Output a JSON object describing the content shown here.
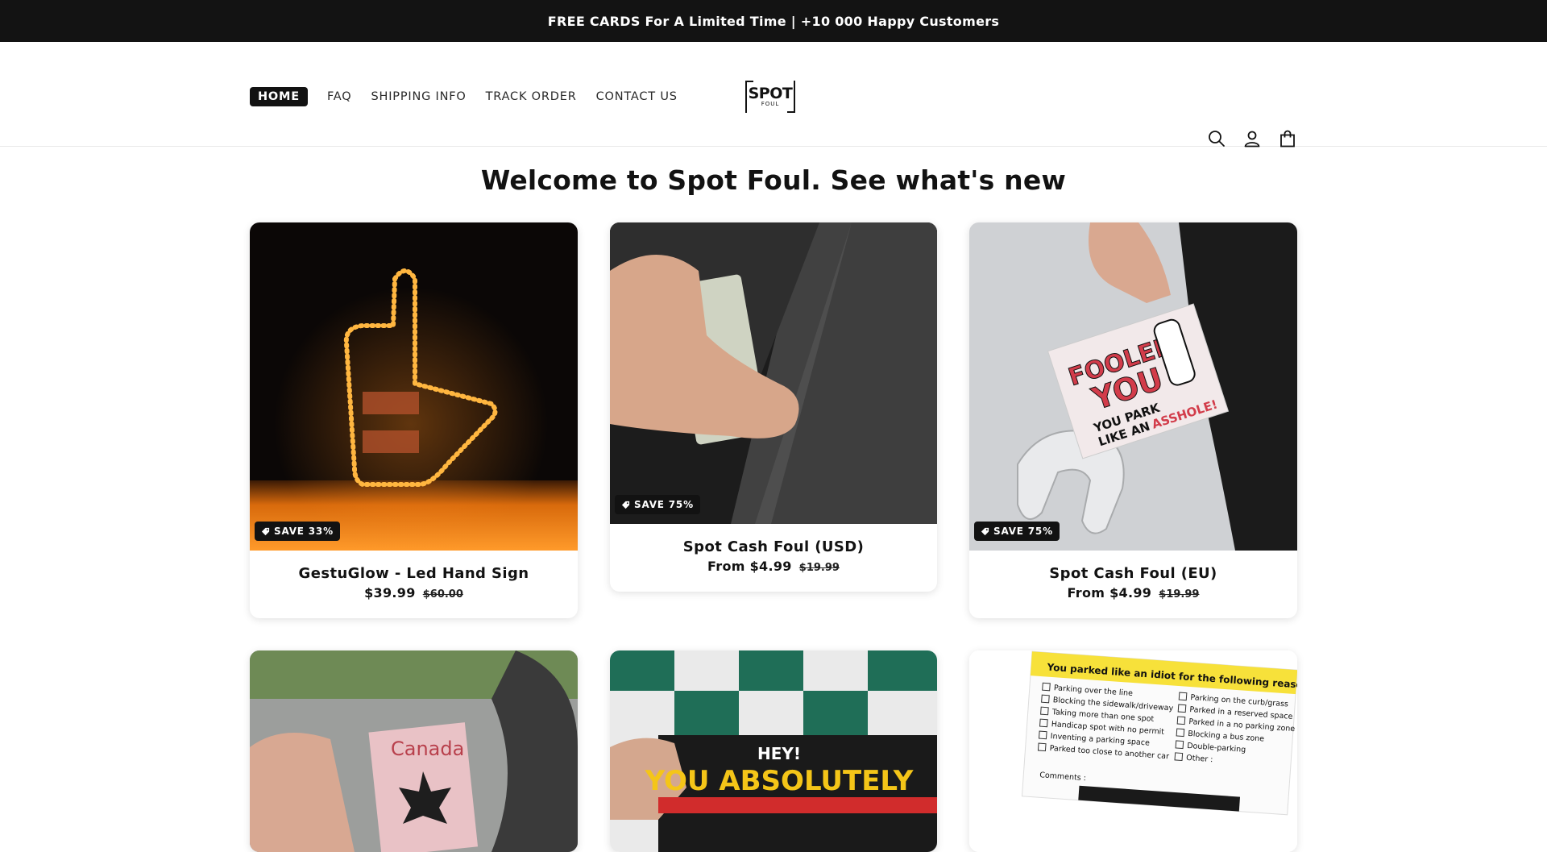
{
  "announcement": "FREE CARDS For A Limited Time | +10 000 Happy Customers",
  "nav": {
    "items": [
      {
        "label": "HOME"
      },
      {
        "label": "FAQ"
      },
      {
        "label": "SHIPPING INFO"
      },
      {
        "label": "TRACK ORDER"
      },
      {
        "label": "CONTACT US"
      }
    ]
  },
  "logo": {
    "big": "SPOT",
    "small": "FOUL"
  },
  "icons": [
    "search-icon",
    "account-icon",
    "cart-icon"
  ],
  "page_title": "Welcome to Spot Foul. See what's new",
  "products": [
    {
      "title": "GestuGlow - Led Hand Sign",
      "price": "$39.99",
      "old_price": "$60.00",
      "badge": "SAVE 33%"
    },
    {
      "title": "Spot Cash Foul (USD)",
      "price": "From $4.99",
      "old_price": "$19.99",
      "badge": "SAVE 75%"
    },
    {
      "title": "Spot Cash Foul (EU)",
      "price": "From $4.99",
      "old_price": "$19.99",
      "badge": "SAVE 75%"
    }
  ],
  "images": {
    "fooled": {
      "line1": "FOOLED",
      "line2": "YOU",
      "line3": "YOU PARK",
      "line4": "LIKE AN",
      "line5": "ASSHOLE!"
    },
    "canada": "Canada",
    "hey": {
      "line1": "HEY!",
      "line2": "YOU ABSOLUTELY"
    },
    "idiot": {
      "header": "You parked like an idiot for the following reason(s):",
      "left": [
        "Parking over the line",
        "Blocking the sidewalk/driveway",
        "Taking more than one spot",
        "Handicap spot with no permit",
        "Inventing a parking space",
        "Parked too close to another car"
      ],
      "right": [
        "Parking on the curb/grass",
        "Parked in a reserved space",
        "Parked in a no parking zone",
        "Blocking a bus zone",
        "Double-parking",
        "Other :"
      ],
      "comments": "Comments :"
    }
  }
}
